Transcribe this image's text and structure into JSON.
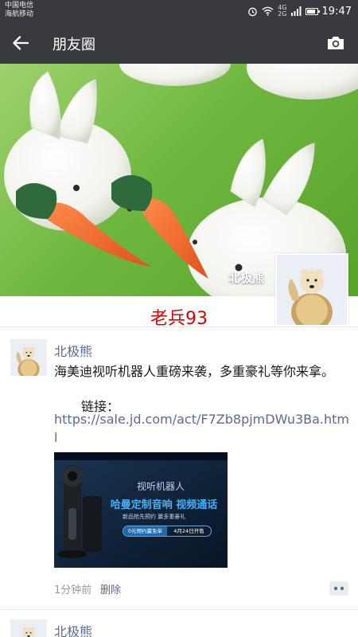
{
  "status_bar": {
    "carrier_1": "中国电信",
    "carrier_2": "海航移动",
    "network_1": "4G",
    "network_2": "2G",
    "time": "19:47",
    "icons": [
      "alarm-icon",
      "wifi-icon",
      "signal-icon",
      "battery-icon"
    ]
  },
  "nav": {
    "title": "朋友圈",
    "back_icon": "back-arrow-icon",
    "camera_icon": "camera-icon"
  },
  "cover": {
    "user_name": "北极熊"
  },
  "signature": "老兵93",
  "posts": [
    {
      "author": "北极熊",
      "text": "海美迪视听机器人重磅来袭，多重豪礼等你来拿。",
      "link_label": "链接：",
      "link": "https://sale.jd.com/act/F7Zb8pjmDWu3Ba.html",
      "image": {
        "headline": "视听机器人",
        "slogan": "哈曼定制音响 视频通话",
        "subline": "新品抢先预约 赢多重豪礼",
        "button_left": "0元预约赢免单",
        "button_right": "4月24日开售"
      },
      "time": "1分钟前",
      "delete_label": "删除"
    },
    {
      "author": "北极熊"
    }
  ],
  "colors": {
    "bar_bg": "#393a3f",
    "link_blue": "#576b95",
    "signature_red": "#e10000"
  }
}
